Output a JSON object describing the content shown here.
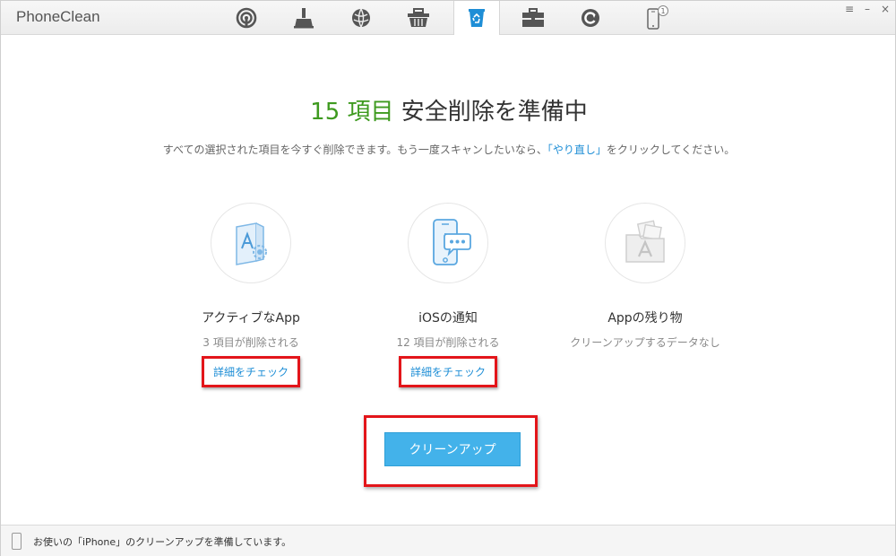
{
  "app": {
    "title": "PhoneClean"
  },
  "toolbar": {
    "items": [
      {
        "name": "speed-up",
        "icon": "radar-icon"
      },
      {
        "name": "clean",
        "icon": "broom-icon"
      },
      {
        "name": "internet",
        "icon": "globe-icon"
      },
      {
        "name": "junk",
        "icon": "basket-icon"
      },
      {
        "name": "privacy",
        "icon": "recycle-bin-icon",
        "active": true
      },
      {
        "name": "toolbox",
        "icon": "toolbox-icon"
      },
      {
        "name": "backup",
        "icon": "restore-icon"
      },
      {
        "name": "device",
        "icon": "phone-icon",
        "badge": "1"
      }
    ],
    "accent": "#1e8ed6"
  },
  "window_controls": {
    "menu": "≡",
    "minimize": "–",
    "close": "×"
  },
  "main": {
    "headline_count": "15 項目",
    "headline_text": "安全削除を準備中",
    "subtext_before": "すべての選択された項目を今すぐ削除できます。もう一度スキャンしたいなら、",
    "subtext_link": "「やり直し」",
    "subtext_after": "をクリックしてください。",
    "features": [
      {
        "name": "アクティブなApp",
        "desc": "3 項目が削除される",
        "detail": "詳細をチェック",
        "icon": "app-document-icon"
      },
      {
        "name": "iOSの通知",
        "desc": "12 項目が削除される",
        "detail": "詳細をチェック",
        "icon": "phone-notification-icon"
      },
      {
        "name": "Appの残り物",
        "desc": "クリーンアップするデータなし",
        "icon": "app-folder-icon"
      }
    ],
    "cleanup_button": "クリーンアップ",
    "success_color": "#3e9a1f",
    "highlight_color": "#e3151a"
  },
  "status": {
    "text": "お使いの「iPhone」のクリーンアップを準備しています。"
  }
}
